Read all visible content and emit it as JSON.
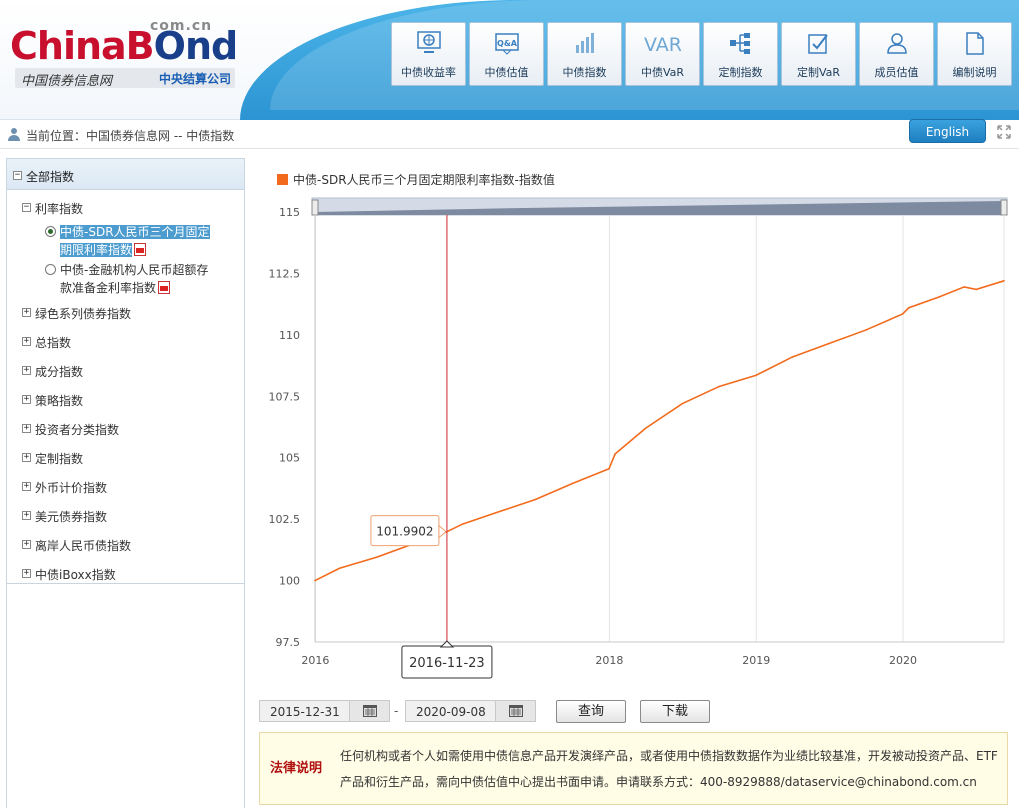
{
  "header": {
    "logo": {
      "main_part1": "ChinaB",
      "main_part2": "nd",
      "com": "com.cn",
      "subtitle": "中国债券信息网",
      "org": "中央结算公司"
    },
    "nav": [
      {
        "label": "中债收益率",
        "icon": "yield-curve-icon"
      },
      {
        "label": "中债估值",
        "icon": "qa-valuation-icon"
      },
      {
        "label": "中债指数",
        "icon": "bar-chart-icon"
      },
      {
        "label": "中债VaR",
        "icon": "var-icon",
        "icon_text": "VAR"
      },
      {
        "label": "定制指数",
        "icon": "hierarchy-icon"
      },
      {
        "label": "定制VaR",
        "icon": "checklist-icon"
      },
      {
        "label": "成员估值",
        "icon": "person-icon"
      },
      {
        "label": "编制说明",
        "icon": "document-icon"
      }
    ]
  },
  "breadcrumb": {
    "label": "当前位置：",
    "path": "中国债券信息网 -- 中债指数"
  },
  "english_button": "English",
  "sidebar": {
    "root": "全部指数",
    "rate_group": "利率指数",
    "leaf1": {
      "label_line1": "中债-SDR人民币三个月固定",
      "label_line2": "期限利率指数",
      "selected": true
    },
    "leaf2": {
      "label_line1": "中债-金融机构人民币超额存",
      "label_line2": "款准备金利率指数",
      "selected": false
    },
    "groups": [
      "绿色系列债券指数",
      "总指数",
      "成分指数",
      "策略指数",
      "投资者分类指数",
      "定制指数",
      "外币计价指数",
      "美元债券指数",
      "离岸人民币债指数",
      "中债iBoxx指数"
    ]
  },
  "chart_data": {
    "type": "line",
    "title": "",
    "series": [
      {
        "name": "中债-SDR人民币三个月固定期限利率指数-指数值",
        "color": "#f26b1d",
        "x": [
          "2015-12-31",
          "2016-03-01",
          "2016-06-01",
          "2016-09-01",
          "2016-11-23",
          "2017-01-01",
          "2017-04-01",
          "2017-07-01",
          "2017-10-01",
          "2017-12-31",
          "2018-01-15",
          "2018-04-01",
          "2018-07-01",
          "2018-10-01",
          "2018-12-31",
          "2019-04-01",
          "2019-07-01",
          "2019-10-01",
          "2019-12-31",
          "2020-01-15",
          "2020-04-01",
          "2020-06-01",
          "2020-07-01",
          "2020-09-08"
        ],
        "y": [
          100.0,
          100.5,
          100.95,
          101.5,
          101.9902,
          102.3,
          102.8,
          103.3,
          103.95,
          104.55,
          105.15,
          106.2,
          107.2,
          107.9,
          108.35,
          109.1,
          109.65,
          110.2,
          110.85,
          111.1,
          111.55,
          111.95,
          111.85,
          112.2
        ]
      }
    ],
    "xlabel": "",
    "ylabel": "",
    "x_ticks": [
      "2016",
      "2016-11-23",
      "2018",
      "2019",
      "2020"
    ],
    "y_ticks": [
      97.5,
      100,
      102.5,
      105,
      107.5,
      110,
      112.5,
      115
    ],
    "ylim": [
      97.5,
      115
    ],
    "xlim": [
      "2015-12-31",
      "2020-09-08"
    ],
    "crosshair": {
      "x": "2016-11-23",
      "value": "101.9902"
    },
    "grid": "vertical",
    "legend": "top-left",
    "navigator": "top"
  },
  "date_range": {
    "start": "2015-12-31",
    "separator": "-",
    "end": "2020-09-08"
  },
  "buttons": {
    "query": "查询",
    "download": "下载"
  },
  "legal": {
    "title": "法律说明",
    "text": "任何机构或者个人如需使用中债信息产品开发演绎产品，或者使用中债指数数据作为业绩比较基准，开发被动投资产品、ETF产品和衍生产品，需向中债估值中心提出书面申请。申请联系方式：400-8929888/dataservice@chinabond.com.cn"
  }
}
